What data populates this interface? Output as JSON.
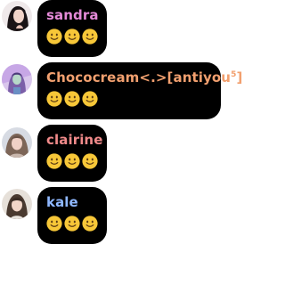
{
  "messages": [
    {
      "username": "sandra",
      "name_color": "#e58ad8",
      "emojis": [
        "slightly-smiling-face",
        "slightly-smiling-face",
        "slightly-smiling-face"
      ]
    },
    {
      "username_prefix": "Chococream<.>[antiyou",
      "username_sup": "5",
      "username_suffix": "]",
      "name_color": "#f2a06f",
      "emojis": [
        "slightly-smiling-face",
        "slightly-smiling-face",
        "slightly-smiling-face"
      ]
    },
    {
      "username": "clairine",
      "name_color": "#f08a8a",
      "emojis": [
        "slightly-smiling-face",
        "slightly-smiling-face",
        "slightly-smiling-face"
      ]
    },
    {
      "username": "kale",
      "name_color": "#8fb8ff",
      "emojis": [
        "slightly-smiling-face",
        "slightly-smiling-face",
        "slightly-smiling-face"
      ]
    }
  ]
}
